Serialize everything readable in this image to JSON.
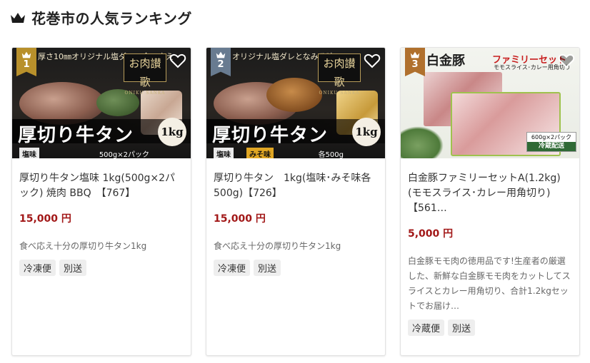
{
  "header": {
    "title": "花巻市の人気ランキング",
    "icon": "crown-icon"
  },
  "colors": {
    "price": "#a21818",
    "rank_1": "#b8902b",
    "rank_2": "#687b90",
    "rank_3": "#b0702d"
  },
  "cards": [
    {
      "rank": "1",
      "image": {
        "tagline": "厚さ10㎜オリジナル塩ダレの食べ応え",
        "brand": "お肉讃歌",
        "brand_sub": "ONIKU SANKA",
        "banner": "厚切り牛タン",
        "badge": "1kg",
        "flavor": "塩味",
        "pack": "500g×2パック"
      },
      "name": "厚切り牛タン塩味 1kg(500g×2パック) 焼肉 BBQ　【767】",
      "price": "15,000 円",
      "description": "食べ応え十分の厚切り牛タン1kg",
      "tags": [
        "冷凍便",
        "別送"
      ]
    },
    {
      "rank": "2",
      "image": {
        "tagline": "オリジナル塩ダレとなみそ味",
        "brand": "お肉讃歌",
        "brand_sub": "ONIKU SANKA",
        "banner": "厚切り牛タン",
        "badge": "1kg",
        "flavor_1": "塩味",
        "flavor_2": "みそ味",
        "pack": "各500g"
      },
      "name": "厚切り牛タン　1kg(塩味･みそ味各500g)【726】",
      "price": "15,000 円",
      "description": "食べ応え十分の厚切り牛タン1kg",
      "tags": [
        "冷凍便",
        "別送"
      ]
    },
    {
      "rank": "3",
      "image": {
        "logo": "白金豚",
        "title": "ファミリーセット",
        "subtitle": "モモスライス･カレー用角切り",
        "pack": "600g×2パック",
        "cold": "冷蔵配送"
      },
      "name": "白金豚ファミリーセットA(1.2kg)(モモスライス･カレー用角切り)【561…",
      "price": "5,000 円",
      "description": "白金豚モモ肉の徳用品です!生産者の厳選した、新鮮な白金豚モモ肉をカットしてスライスとカレー用角切り、合計1.2kgセットでお届け…",
      "tags": [
        "冷蔵便",
        "別送"
      ]
    }
  ]
}
